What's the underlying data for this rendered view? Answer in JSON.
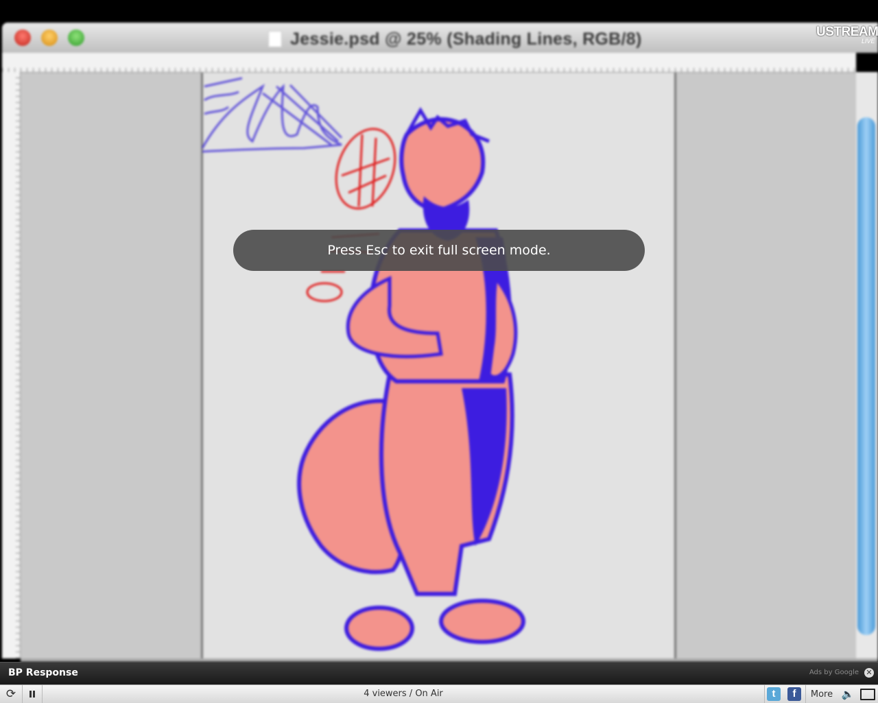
{
  "stream": {
    "brand": "USTREAM",
    "brand_badge": "LIVE",
    "fullscreen_notice": "Press Esc to exit full screen mode."
  },
  "photoshop": {
    "document_title": "Jessie.psd @ 25% (Shading Lines, RGB/8)"
  },
  "channel": {
    "title": "BP Response",
    "ads_label": "Ads by Google"
  },
  "player": {
    "status": "4 viewers / On Air",
    "more_label": "More",
    "icons": [
      "refresh-icon",
      "pause-icon",
      "twitter-icon",
      "facebook-icon",
      "volume-icon",
      "fullscreen-icon"
    ]
  },
  "colors": {
    "fill_pink": "#f3938c",
    "shade_blue": "#3d1de0",
    "sketch_red": "#e02020",
    "sketch_blue": "#4a3ad8"
  }
}
